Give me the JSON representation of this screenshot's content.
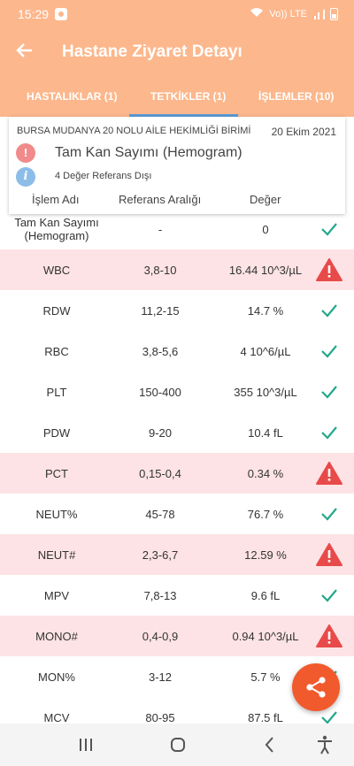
{
  "status_bar": {
    "time": "15:29",
    "network": "Vo)) LTE"
  },
  "header": {
    "title": "Hastane Ziyaret Detayı"
  },
  "tabs": [
    {
      "label": "HASTALIKLAR (1)"
    },
    {
      "label": "TETKİKLER (1)"
    },
    {
      "label": "İŞLEMLER (10)"
    }
  ],
  "info_card": {
    "institution": "BURSA MUDANYA 20 NOLU AİLE HEKİMLİĞİ BİRİMİ",
    "date": "20 Ekim 2021",
    "test_name": "Tam Kan Sayımı (Hemogram)",
    "note": "4 Değer Referans Dışı",
    "columns": [
      "İşlem Adı",
      "Referans Aralığı",
      "Değer"
    ]
  },
  "rows": [
    {
      "name": "Tam Kan Sayımı (Hemogram)",
      "ref": "-",
      "value": "0",
      "status": "ok"
    },
    {
      "name": "WBC",
      "ref": "3,8-10",
      "value": "16.44 10^3/µL",
      "status": "warn"
    },
    {
      "name": "RDW",
      "ref": "11,2-15",
      "value": "14.7 %",
      "status": "ok"
    },
    {
      "name": "RBC",
      "ref": "3,8-5,6",
      "value": "4 10^6/µL",
      "status": "ok"
    },
    {
      "name": "PLT",
      "ref": "150-400",
      "value": "355 10^3/µL",
      "status": "ok"
    },
    {
      "name": "PDW",
      "ref": "9-20",
      "value": "10.4 fL",
      "status": "ok"
    },
    {
      "name": "PCT",
      "ref": "0,15-0,4",
      "value": "0.34 %",
      "status": "warn"
    },
    {
      "name": "NEUT%",
      "ref": "45-78",
      "value": "76.7 %",
      "status": "ok"
    },
    {
      "name": "NEUT#",
      "ref": "2,3-6,7",
      "value": "12.59 %",
      "status": "warn"
    },
    {
      "name": "MPV",
      "ref": "7,8-13",
      "value": "9.6 fL",
      "status": "ok"
    },
    {
      "name": "MONO#",
      "ref": "0,4-0,9",
      "value": "0.94 10^3/µL",
      "status": "warn"
    },
    {
      "name": "MON%",
      "ref": "3-12",
      "value": "5.7 %",
      "status": "ok"
    },
    {
      "name": "MCV",
      "ref": "80-95",
      "value": "87.5 fL",
      "status": "ok"
    }
  ],
  "colors": {
    "accent": "#fcb78c",
    "tab_indicator": "#5b9bd5",
    "warn_row": "#fde3e5",
    "warn_icon": "#e84a4a",
    "ok_icon": "#21a88a",
    "fab": "#f15a2c"
  },
  "icons": {
    "back": "arrow-left-icon",
    "share": "share-icon",
    "alert": "warning-triangle-icon",
    "ok": "check-icon"
  }
}
